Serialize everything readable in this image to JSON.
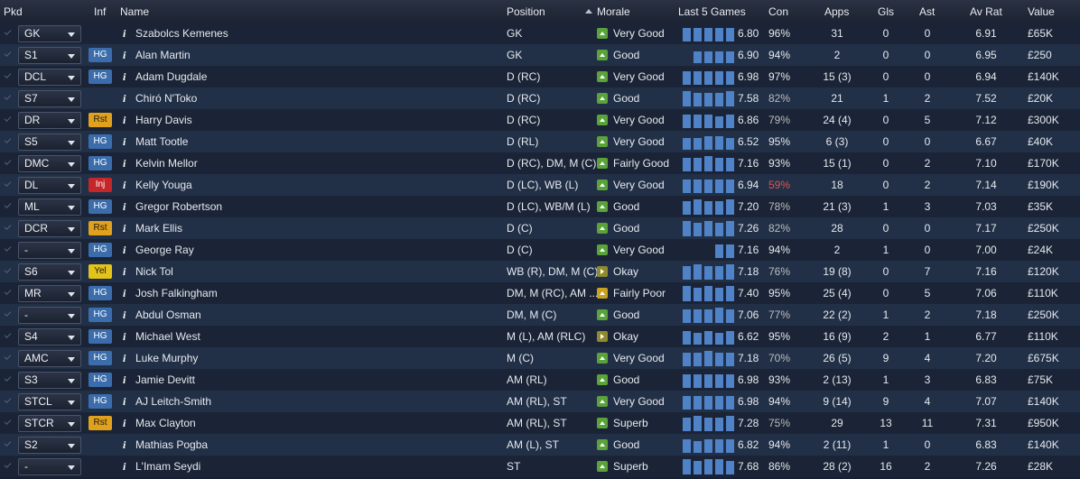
{
  "headers": {
    "pkd": "Pkd",
    "inf": "Inf",
    "name": "Name",
    "position": "Position",
    "morale": "Morale",
    "last5": "Last 5 Games",
    "con": "Con",
    "apps": "Apps",
    "gls": "Gls",
    "ast": "Ast",
    "avrat": "Av Rat",
    "value": "Value"
  },
  "colors": {
    "morale_green": "#5aa33a",
    "morale_olive": "#8f8a2e",
    "morale_amber": "#c9a11f",
    "badge_hg": "#3b6dac",
    "badge_rst": "#e0a11c",
    "badge_inj": "#c4262a",
    "badge_yel": "#e3c21a",
    "bar": "#4f82c6"
  },
  "rows": [
    {
      "pkd": "GK",
      "inf": "",
      "name": "Szabolcs Kemenes",
      "position": "GK",
      "morale": "Very Good",
      "morale_icon": "up-arrow-green",
      "last5": [
        7,
        7,
        7,
        7,
        7
      ],
      "rating5": "6.80",
      "con": "96%",
      "con_level": "ok",
      "apps": "31",
      "gls": "0",
      "ast": "0",
      "avrat": "6.91",
      "value": "£65K"
    },
    {
      "pkd": "S1",
      "inf": "HG",
      "name": "Alan Martin",
      "position": "GK",
      "morale": "Good",
      "morale_icon": "up-arrow-green",
      "last5": [
        0,
        6,
        6,
        6,
        6
      ],
      "rating5": "6.90",
      "con": "94%",
      "con_level": "ok",
      "apps": "2",
      "gls": "0",
      "ast": "0",
      "avrat": "6.95",
      "value": "£250"
    },
    {
      "pkd": "DCL",
      "inf": "HG",
      "name": "Adam Dugdale",
      "position": "D (RC)",
      "morale": "Very Good",
      "morale_icon": "up-arrow-green",
      "last5": [
        7,
        7,
        7,
        7,
        7
      ],
      "rating5": "6.98",
      "con": "97%",
      "con_level": "ok",
      "apps": "15 (3)",
      "gls": "0",
      "ast": "0",
      "avrat": "6.94",
      "value": "£140K"
    },
    {
      "pkd": "S7",
      "inf": "",
      "name": "Chiró N'Toko",
      "position": "D (RC)",
      "morale": "Good",
      "morale_icon": "up-arrow-green",
      "last5": [
        8,
        7,
        7,
        7,
        8
      ],
      "rating5": "7.58",
      "con": "82%",
      "con_level": "warn",
      "apps": "21",
      "gls": "1",
      "ast": "2",
      "avrat": "7.52",
      "value": "£20K"
    },
    {
      "pkd": "DR",
      "inf": "Rst",
      "name": "Harry Davis",
      "position": "D (RC)",
      "morale": "Very Good",
      "morale_icon": "up-arrow-green",
      "last5": [
        7,
        7,
        7,
        6,
        7
      ],
      "rating5": "6.86",
      "con": "79%",
      "con_level": "warn",
      "apps": "24 (4)",
      "gls": "0",
      "ast": "5",
      "avrat": "7.12",
      "value": "£300K"
    },
    {
      "pkd": "S5",
      "inf": "HG",
      "name": "Matt Tootle",
      "position": "D (RL)",
      "morale": "Very Good",
      "morale_icon": "up-arrow-green",
      "last5": [
        6,
        6,
        7,
        7,
        6
      ],
      "rating5": "6.52",
      "con": "95%",
      "con_level": "ok",
      "apps": "6 (3)",
      "gls": "0",
      "ast": "0",
      "avrat": "6.67",
      "value": "£40K"
    },
    {
      "pkd": "DMC",
      "inf": "HG",
      "name": "Kelvin Mellor",
      "position": "D (RC), DM, M (C)",
      "morale": "Fairly Good",
      "morale_icon": "up-arrow-green",
      "last5": [
        7,
        7,
        8,
        7,
        7
      ],
      "rating5": "7.16",
      "con": "93%",
      "con_level": "ok",
      "apps": "15 (1)",
      "gls": "0",
      "ast": "2",
      "avrat": "7.10",
      "value": "£170K"
    },
    {
      "pkd": "DL",
      "inf": "Inj",
      "name": "Kelly Youga",
      "position": "D (LC), WB (L)",
      "morale": "Very Good",
      "morale_icon": "up-arrow-green",
      "last5": [
        7,
        7,
        7,
        7,
        7
      ],
      "rating5": "6.94",
      "con": "59%",
      "con_level": "bad",
      "apps": "18",
      "gls": "0",
      "ast": "2",
      "avrat": "7.14",
      "value": "£190K"
    },
    {
      "pkd": "ML",
      "inf": "HG",
      "name": "Gregor Robertson",
      "position": "D (LC), WB/M (L)",
      "morale": "Good",
      "morale_icon": "up-arrow-green",
      "last5": [
        7,
        8,
        7,
        7,
        8
      ],
      "rating5": "7.20",
      "con": "78%",
      "con_level": "warn",
      "apps": "21 (3)",
      "gls": "1",
      "ast": "3",
      "avrat": "7.03",
      "value": "£35K"
    },
    {
      "pkd": "DCR",
      "inf": "Rst",
      "name": "Mark Ellis",
      "position": "D (C)",
      "morale": "Good",
      "morale_icon": "up-arrow-green",
      "last5": [
        8,
        7,
        8,
        7,
        8
      ],
      "rating5": "7.26",
      "con": "82%",
      "con_level": "warn",
      "apps": "28",
      "gls": "0",
      "ast": "0",
      "avrat": "7.17",
      "value": "£250K"
    },
    {
      "pkd": "-",
      "inf": "HG",
      "name": "George Ray",
      "position": "D (C)",
      "morale": "Very Good",
      "morale_icon": "up-arrow-green",
      "last5": [
        0,
        0,
        0,
        7,
        7
      ],
      "rating5": "7.16",
      "con": "94%",
      "con_level": "ok",
      "apps": "2",
      "gls": "1",
      "ast": "0",
      "avrat": "7.00",
      "value": "£24K"
    },
    {
      "pkd": "S6",
      "inf": "Yel",
      "name": "Nick Tol",
      "position": "WB (R), DM, M (C)",
      "morale": "Okay",
      "morale_icon": "right-arrow-olive",
      "last5": [
        7,
        8,
        7,
        7,
        8
      ],
      "rating5": "7.18",
      "con": "76%",
      "con_level": "warn",
      "apps": "19 (8)",
      "gls": "0",
      "ast": "7",
      "avrat": "7.16",
      "value": "£120K"
    },
    {
      "pkd": "MR",
      "inf": "HG",
      "name": "Josh Falkingham",
      "position": "DM, M (RC), AM ...",
      "morale": "Fairly Poor",
      "morale_icon": "up-arrow-amber",
      "last5": [
        8,
        7,
        8,
        7,
        8
      ],
      "rating5": "7.40",
      "con": "95%",
      "con_level": "ok",
      "apps": "25 (4)",
      "gls": "0",
      "ast": "5",
      "avrat": "7.06",
      "value": "£110K"
    },
    {
      "pkd": "-",
      "inf": "HG",
      "name": "Abdul Osman",
      "position": "DM, M (C)",
      "morale": "Good",
      "morale_icon": "up-arrow-green",
      "last5": [
        7,
        7,
        7,
        8,
        7
      ],
      "rating5": "7.06",
      "con": "77%",
      "con_level": "warn",
      "apps": "22 (2)",
      "gls": "1",
      "ast": "2",
      "avrat": "7.18",
      "value": "£250K"
    },
    {
      "pkd": "S4",
      "inf": "HG",
      "name": "Michael West",
      "position": "M (L), AM (RLC)",
      "morale": "Okay",
      "morale_icon": "right-arrow-olive",
      "last5": [
        7,
        6,
        7,
        6,
        7
      ],
      "rating5": "6.62",
      "con": "95%",
      "con_level": "ok",
      "apps": "16 (9)",
      "gls": "2",
      "ast": "1",
      "avrat": "6.77",
      "value": "£110K"
    },
    {
      "pkd": "AMC",
      "inf": "HG",
      "name": "Luke Murphy",
      "position": "M (C)",
      "morale": "Very Good",
      "morale_icon": "up-arrow-green",
      "last5": [
        7,
        7,
        8,
        7,
        7
      ],
      "rating5": "7.18",
      "con": "70%",
      "con_level": "warn",
      "apps": "26 (5)",
      "gls": "9",
      "ast": "4",
      "avrat": "7.20",
      "value": "£675K"
    },
    {
      "pkd": "S3",
      "inf": "HG",
      "name": "Jamie Devitt",
      "position": "AM (RL)",
      "morale": "Good",
      "morale_icon": "up-arrow-green",
      "last5": [
        7,
        7,
        7,
        7,
        7
      ],
      "rating5": "6.98",
      "con": "93%",
      "con_level": "ok",
      "apps": "2 (13)",
      "gls": "1",
      "ast": "3",
      "avrat": "6.83",
      "value": "£75K"
    },
    {
      "pkd": "STCL",
      "inf": "HG",
      "name": "AJ Leitch-Smith",
      "position": "AM (RL), ST",
      "morale": "Very Good",
      "morale_icon": "up-arrow-green",
      "last5": [
        7,
        7,
        7,
        7,
        7
      ],
      "rating5": "6.98",
      "con": "94%",
      "con_level": "ok",
      "apps": "9 (14)",
      "gls": "9",
      "ast": "4",
      "avrat": "7.07",
      "value": "£140K"
    },
    {
      "pkd": "STCR",
      "inf": "Rst",
      "name": "Max Clayton",
      "position": "AM (RL), ST",
      "morale": "Superb",
      "morale_icon": "up-arrow-green",
      "last5": [
        7,
        8,
        7,
        7,
        8
      ],
      "rating5": "7.28",
      "con": "75%",
      "con_level": "warn",
      "apps": "29",
      "gls": "13",
      "ast": "11",
      "avrat": "7.31",
      "value": "£950K"
    },
    {
      "pkd": "S2",
      "inf": "",
      "name": "Mathias Pogba",
      "position": "AM (L), ST",
      "morale": "Good",
      "morale_icon": "up-arrow-green",
      "last5": [
        7,
        6,
        7,
        7,
        7
      ],
      "rating5": "6.82",
      "con": "94%",
      "con_level": "ok",
      "apps": "2 (11)",
      "gls": "1",
      "ast": "0",
      "avrat": "6.83",
      "value": "£140K"
    },
    {
      "pkd": "-",
      "inf": "",
      "name": "L'Imam Seydi",
      "position": "ST",
      "morale": "Superb",
      "morale_icon": "up-arrow-green",
      "last5": [
        8,
        7,
        8,
        8,
        7
      ],
      "rating5": "7.68",
      "con": "86%",
      "con_level": "ok",
      "apps": "28 (2)",
      "gls": "16",
      "ast": "2",
      "avrat": "7.26",
      "value": "£28K"
    }
  ]
}
